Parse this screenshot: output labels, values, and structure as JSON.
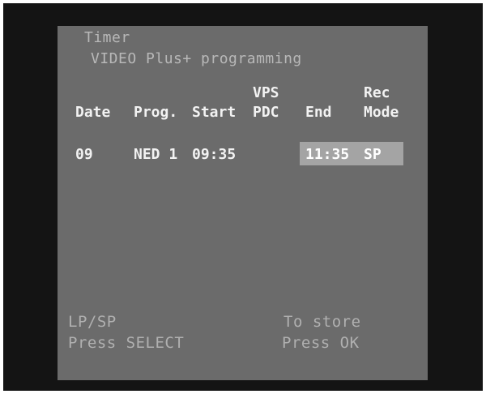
{
  "screen": {
    "title": "Timer",
    "subtitle": "VIDEO Plus+ programming"
  },
  "columns": {
    "date": "Date",
    "prog": "Prog.",
    "start": "Start",
    "vps_top": "VPS",
    "vps_bottom": "PDC",
    "end": "End",
    "rec_top": "Rec",
    "rec_bottom": "Mode"
  },
  "entry": {
    "date": "09",
    "prog": "NED 1",
    "start": "09:35",
    "vps": "",
    "end": "11:35",
    "mode": "SP"
  },
  "footer": {
    "left_line1": "LP/SP",
    "left_line2": "Press SELECT",
    "right_line1": "To store",
    "right_line2": "Press OK"
  },
  "colors": {
    "osd_background": "#6b6b6b",
    "highlight": "#a4a4a4",
    "frame": "#141414"
  }
}
